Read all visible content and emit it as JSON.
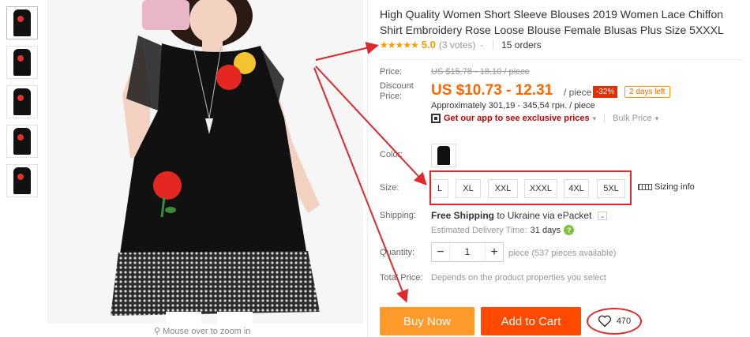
{
  "gallery": {
    "thumbnails": 5,
    "zoom_hint": "Mouse over to zoom in"
  },
  "product": {
    "title": "High Quality Women Short Sleeve Blouses 2019 Women Lace Chiffon Shirt Embroidery Rose Loose Blouse Female Blusas Plus Size 5XXXL",
    "stars": "★★★★★",
    "rating": "5.0",
    "votes": "(3 votes)",
    "orders": "15 orders"
  },
  "price": {
    "label": "Price:",
    "old": "US $15.78 - 18.10 / piece",
    "discount_label_1": "Discount",
    "discount_label_2": "Price:",
    "current": "US $10.73 - 12.31",
    "per_piece": "/ piece",
    "discount_pct": "-32%",
    "days_left": "2 days left",
    "approx": "Approximately 301,19 - 345,54 грн. / piece",
    "app_link": "Get our app to see exclusive prices",
    "bulk": "Bulk Price"
  },
  "options": {
    "color_label": "Color:",
    "size_label": "Size:",
    "sizes": [
      "L",
      "XL",
      "XXL",
      "XXXL",
      "4XL",
      "5XL"
    ],
    "sizing_info": "Sizing info"
  },
  "shipping": {
    "label": "Shipping:",
    "free": "Free Shipping",
    "to": "to Ukraine via ePacket",
    "est_label": "Estimated Delivery Time:",
    "est_days": "31 days"
  },
  "quantity": {
    "label": "Quantity:",
    "minus": "−",
    "value": "1",
    "plus": "+",
    "available": "piece (537 pieces available)"
  },
  "total": {
    "label": "Total Price:",
    "value": "Depends on the product properties you select"
  },
  "actions": {
    "buy_now": "Buy Now",
    "add_to_cart": "Add to Cart",
    "wishlist_count": "470"
  },
  "colors": {
    "accent_orange": "#ff9a2b",
    "cart_red": "#ff4a00",
    "annotation_red": "#e0282d"
  }
}
